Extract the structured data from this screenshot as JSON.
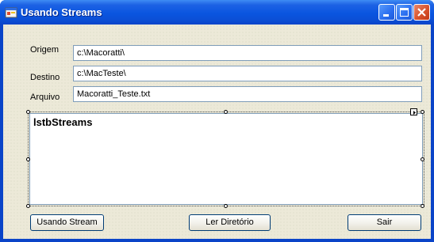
{
  "window": {
    "title": "Usando Streams",
    "icon": "form-app-icon"
  },
  "form": {
    "origem": {
      "label": "Origem",
      "value": "c:\\Macoratti\\"
    },
    "destino": {
      "label": "Destino",
      "value": "c:\\MacTeste\\"
    },
    "arquivo": {
      "label": "Arquivo",
      "value": "Macoratti_Teste.txt"
    }
  },
  "listbox": {
    "name": "lstbStreams"
  },
  "buttons": {
    "usando_stream": "Usando Stream",
    "ler_diretorio": "Ler Diretório",
    "sair": "Sair"
  },
  "colors": {
    "titlebar": "#0a55e0",
    "client_bg": "#ece9d8",
    "close_button": "#d8532c",
    "input_border": "#7f9db9"
  }
}
